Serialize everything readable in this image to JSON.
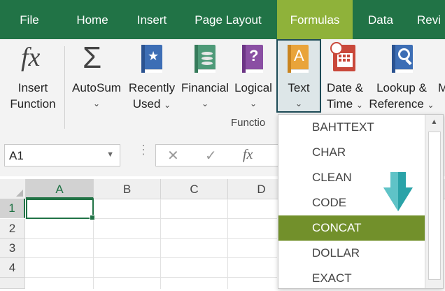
{
  "tabs": [
    {
      "label": "File",
      "active": false
    },
    {
      "label": "Home",
      "active": false
    },
    {
      "label": "Insert",
      "active": false
    },
    {
      "label": "Page Layout",
      "active": false
    },
    {
      "label": "Formulas",
      "active": true
    },
    {
      "label": "Data",
      "active": false
    },
    {
      "label": "Revi",
      "active": false
    }
  ],
  "ribbon": {
    "insert_function": {
      "line1": "Insert",
      "line2": "Function",
      "icon_text": "fx"
    },
    "autosum": {
      "label": "AutoSum",
      "icon_text": "Σ"
    },
    "recently_used": {
      "line1": "Recently",
      "line2": "Used"
    },
    "financial": {
      "label": "Financial"
    },
    "logical": {
      "label": "Logical",
      "icon_text": "?"
    },
    "text": {
      "label": "Text",
      "icon_text": "A"
    },
    "date_time": {
      "line1": "Date &",
      "line2": "Time"
    },
    "lookup": {
      "line1": "Lookup &",
      "line2": "Reference"
    },
    "more": {
      "label": "M"
    },
    "group_label": "Functio"
  },
  "formula_bar": {
    "name_box": "A1",
    "cancel_icon": "✕",
    "enter_icon": "✓",
    "fx_icon": "fx"
  },
  "grid": {
    "columns": [
      "A",
      "B",
      "C",
      "D"
    ],
    "rows": [
      "1",
      "2",
      "3",
      "4"
    ],
    "active_cell": "A1"
  },
  "dropdown": {
    "items": [
      "BAHTTEXT",
      "CHAR",
      "CLEAN",
      "CODE",
      "CONCAT",
      "DOLLAR",
      "EXACT"
    ],
    "highlighted": "CONCAT"
  },
  "colors": {
    "tab_bar": "#217346",
    "active_tab": "#8fb23a",
    "highlight": "#72902b",
    "arrow": "#2aa3a8"
  }
}
